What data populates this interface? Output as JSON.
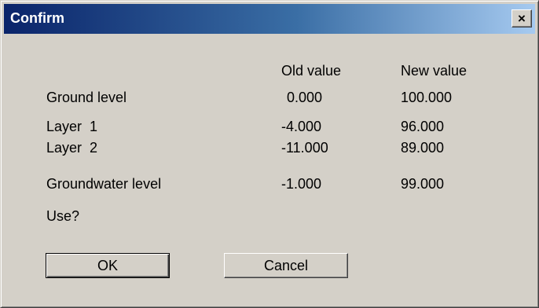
{
  "window": {
    "title": "Confirm",
    "close_glyph": "×"
  },
  "columns": {
    "old": "Old value",
    "new": "New value"
  },
  "rows": [
    {
      "label": "Ground level",
      "old": "0.000",
      "new": "100.000"
    },
    {
      "label": "Layer  1",
      "old": "-4.000",
      "new": "96.000"
    },
    {
      "label": "Layer  2",
      "old": "-11.000",
      "new": "89.000"
    },
    {
      "label": "Groundwater level",
      "old": "-1.000",
      "new": "99.000"
    }
  ],
  "prompt": "Use?",
  "buttons": {
    "ok": "OK",
    "cancel": "Cancel"
  }
}
